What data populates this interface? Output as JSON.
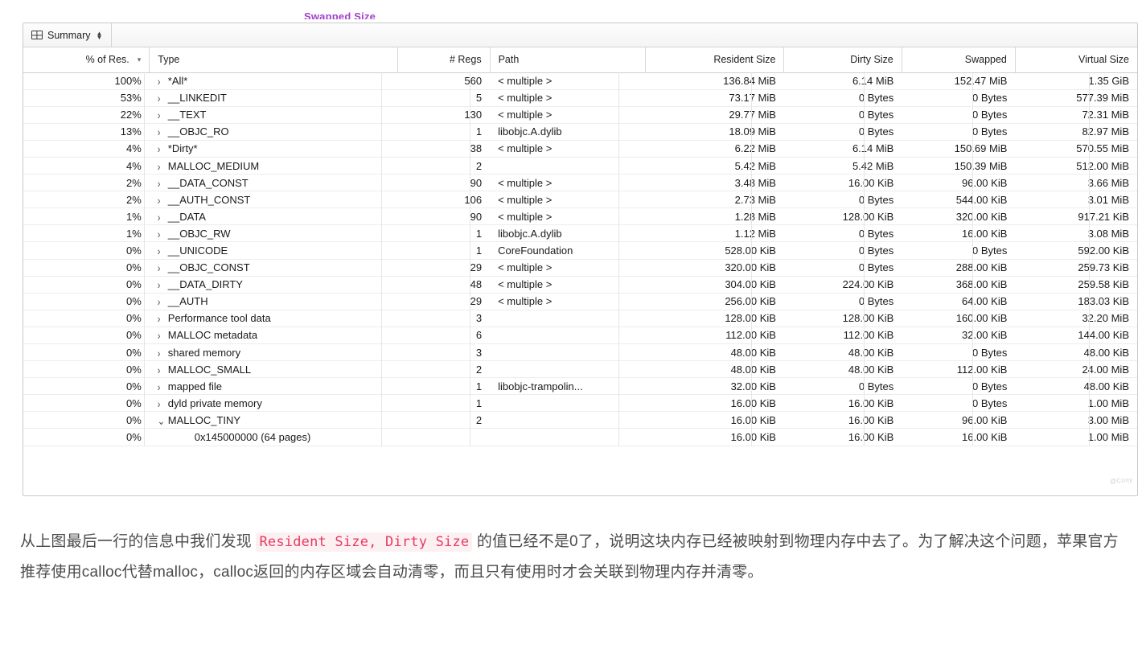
{
  "clipped_label": "Swapped Size",
  "panel": {
    "toolbar": {
      "summary_label": "Summary",
      "grid_icon": "grid-icon",
      "stepper_icon": "up-down-chevrons-icon"
    },
    "table": {
      "columns": [
        {
          "key": "pct",
          "label": "% of Res.",
          "sorted": true,
          "sort_icon": "chevron-down-icon"
        },
        {
          "key": "type",
          "label": "Type",
          "sorted": false
        },
        {
          "key": "regs",
          "label": "# Regs",
          "sorted": false
        },
        {
          "key": "path",
          "label": "Path",
          "sorted": false
        },
        {
          "key": "res",
          "label": "Resident Size",
          "sorted": false
        },
        {
          "key": "dirty",
          "label": "Dirty Size",
          "sorted": false
        },
        {
          "key": "swap",
          "label": "Swapped",
          "sorted": false
        },
        {
          "key": "virt",
          "label": "Virtual Size",
          "sorted": false
        }
      ],
      "rows": [
        {
          "pct": "100%",
          "disclosure": "collapsed",
          "type": "*All*",
          "regs": "560",
          "path": "< multiple >",
          "res": "136.84 MiB",
          "dirty": "6.14 MiB",
          "swap": "152.47 MiB",
          "virt": "1.35 GiB",
          "child": false
        },
        {
          "pct": "53%",
          "disclosure": "collapsed",
          "type": "__LINKEDIT",
          "regs": "5",
          "path": "< multiple >",
          "res": "73.17 MiB",
          "dirty": "0 Bytes",
          "swap": "0 Bytes",
          "virt": "577.39 MiB",
          "child": false
        },
        {
          "pct": "22%",
          "disclosure": "collapsed",
          "type": "__TEXT",
          "regs": "130",
          "path": "< multiple >",
          "res": "29.77 MiB",
          "dirty": "0 Bytes",
          "swap": "0 Bytes",
          "virt": "72.31 MiB",
          "child": false
        },
        {
          "pct": "13%",
          "disclosure": "collapsed",
          "type": "__OBJC_RO",
          "regs": "1",
          "path": "libobjc.A.dylib",
          "res": "18.09 MiB",
          "dirty": "0 Bytes",
          "swap": "0 Bytes",
          "virt": "82.97 MiB",
          "child": false
        },
        {
          "pct": "4%",
          "disclosure": "collapsed",
          "type": "*Dirty*",
          "regs": "38",
          "path": "< multiple >",
          "res": "6.22 MiB",
          "dirty": "6.14 MiB",
          "swap": "150.69 MiB",
          "virt": "570.55 MiB",
          "child": false
        },
        {
          "pct": "4%",
          "disclosure": "collapsed",
          "type": "MALLOC_MEDIUM",
          "regs": "2",
          "path": "",
          "res": "5.42 MiB",
          "dirty": "5.42 MiB",
          "swap": "150.39 MiB",
          "virt": "512.00 MiB",
          "child": false
        },
        {
          "pct": "2%",
          "disclosure": "collapsed",
          "type": "__DATA_CONST",
          "regs": "90",
          "path": "< multiple >",
          "res": "3.48 MiB",
          "dirty": "16.00 KiB",
          "swap": "96.00 KiB",
          "virt": "3.66 MiB",
          "child": false
        },
        {
          "pct": "2%",
          "disclosure": "collapsed",
          "type": "__AUTH_CONST",
          "regs": "106",
          "path": "< multiple >",
          "res": "2.73 MiB",
          "dirty": "0 Bytes",
          "swap": "544.00 KiB",
          "virt": "3.01 MiB",
          "child": false
        },
        {
          "pct": "1%",
          "disclosure": "collapsed",
          "type": "__DATA",
          "regs": "90",
          "path": "< multiple >",
          "res": "1.28 MiB",
          "dirty": "128.00 KiB",
          "swap": "320.00 KiB",
          "virt": "917.21 KiB",
          "child": false
        },
        {
          "pct": "1%",
          "disclosure": "collapsed",
          "type": "__OBJC_RW",
          "regs": "1",
          "path": "libobjc.A.dylib",
          "res": "1.12 MiB",
          "dirty": "0 Bytes",
          "swap": "16.00 KiB",
          "virt": "3.08 MiB",
          "child": false
        },
        {
          "pct": "0%",
          "disclosure": "collapsed",
          "type": "__UNICODE",
          "regs": "1",
          "path": "CoreFoundation",
          "res": "528.00 KiB",
          "dirty": "0 Bytes",
          "swap": "0 Bytes",
          "virt": "592.00 KiB",
          "child": false
        },
        {
          "pct": "0%",
          "disclosure": "collapsed",
          "type": "__OBJC_CONST",
          "regs": "29",
          "path": "< multiple >",
          "res": "320.00 KiB",
          "dirty": "0 Bytes",
          "swap": "288.00 KiB",
          "virt": "259.73 KiB",
          "child": false
        },
        {
          "pct": "0%",
          "disclosure": "collapsed",
          "type": "__DATA_DIRTY",
          "regs": "48",
          "path": "< multiple >",
          "res": "304.00 KiB",
          "dirty": "224.00 KiB",
          "swap": "368.00 KiB",
          "virt": "259.58 KiB",
          "child": false
        },
        {
          "pct": "0%",
          "disclosure": "collapsed",
          "type": "__AUTH",
          "regs": "29",
          "path": "< multiple >",
          "res": "256.00 KiB",
          "dirty": "0 Bytes",
          "swap": "64.00 KiB",
          "virt": "183.03 KiB",
          "child": false
        },
        {
          "pct": "0%",
          "disclosure": "collapsed",
          "type": "Performance tool data",
          "regs": "3",
          "path": "",
          "res": "128.00 KiB",
          "dirty": "128.00 KiB",
          "swap": "160.00 KiB",
          "virt": "32.20 MiB",
          "child": false
        },
        {
          "pct": "0%",
          "disclosure": "collapsed",
          "type": "MALLOC metadata",
          "regs": "6",
          "path": "",
          "res": "112.00 KiB",
          "dirty": "112.00 KiB",
          "swap": "32.00 KiB",
          "virt": "144.00 KiB",
          "child": false
        },
        {
          "pct": "0%",
          "disclosure": "collapsed",
          "type": "shared memory",
          "regs": "3",
          "path": "",
          "res": "48.00 KiB",
          "dirty": "48.00 KiB",
          "swap": "0 Bytes",
          "virt": "48.00 KiB",
          "child": false
        },
        {
          "pct": "0%",
          "disclosure": "collapsed",
          "type": "MALLOC_SMALL",
          "regs": "2",
          "path": "",
          "res": "48.00 KiB",
          "dirty": "48.00 KiB",
          "swap": "112.00 KiB",
          "virt": "24.00 MiB",
          "child": false
        },
        {
          "pct": "0%",
          "disclosure": "collapsed",
          "type": "mapped file",
          "regs": "1",
          "path": "libobjc-trampolin...",
          "res": "32.00 KiB",
          "dirty": "0 Bytes",
          "swap": "0 Bytes",
          "virt": "48.00 KiB",
          "child": false
        },
        {
          "pct": "0%",
          "disclosure": "collapsed",
          "type": "dyld private memory",
          "regs": "1",
          "path": "",
          "res": "16.00 KiB",
          "dirty": "16.00 KiB",
          "swap": "0 Bytes",
          "virt": "1.00 MiB",
          "child": false
        },
        {
          "pct": "0%",
          "disclosure": "expanded",
          "type": "MALLOC_TINY",
          "regs": "2",
          "path": "",
          "res": "16.00 KiB",
          "dirty": "16.00 KiB",
          "swap": "96.00 KiB",
          "virt": "3.00 MiB",
          "child": false
        },
        {
          "pct": "0%",
          "disclosure": "none",
          "type": "0x145000000 (64 pages)",
          "regs": "",
          "path": "",
          "res": "16.00 KiB",
          "dirty": "16.00 KiB",
          "swap": "16.00 KiB",
          "virt": "1.00 MiB",
          "child": true
        }
      ]
    }
  },
  "prose": {
    "part1": "从上图最后一行的信息中我们发现 ",
    "code": "Resident Size, Dirty Size",
    "part2": " 的值已经不是0了，说明这块内存已经被映射到物理内存中去了。为了解决这个问题，苹果官方推荐使用calloc代替malloc，calloc返回的内存区域会自动清零，而且只有使用时才会关联到物理内存并清零。"
  },
  "colors": {
    "accent_purple": "#a43fce",
    "code_pink": "#e8395f",
    "code_bg": "#fdf0f3",
    "panel_border": "#c9c9c9"
  }
}
